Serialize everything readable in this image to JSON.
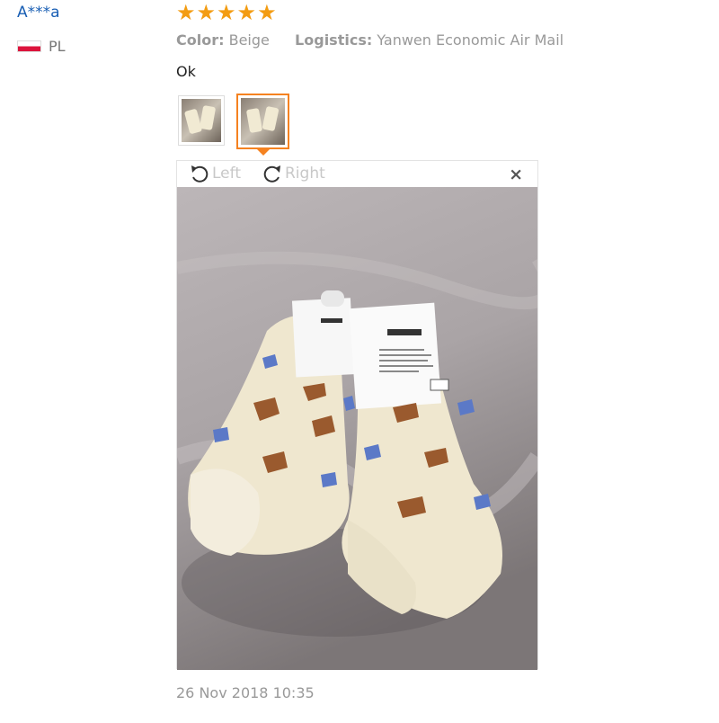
{
  "reviewer": {
    "name": "A***a",
    "country_code": "PL",
    "flag": "poland-flag"
  },
  "rating": {
    "stars": 5,
    "max": 5,
    "star_glyph": "★",
    "color": "#f39c12"
  },
  "attributes": {
    "color_label": "Color:",
    "color_value": "Beige",
    "logistics_label": "Logistics:",
    "logistics_value": "Yanwen Economic Air Mail"
  },
  "review": {
    "text": "Ok"
  },
  "thumbnails": [
    {
      "name": "photo-thumbnail-1",
      "selected": false
    },
    {
      "name": "photo-thumbnail-2",
      "selected": true
    }
  ],
  "viewer": {
    "rotate_left_label": "Left",
    "rotate_right_label": "Right",
    "close_glyph": "×",
    "accent": "#f58220"
  },
  "date": "26 Nov 2018 10:35"
}
